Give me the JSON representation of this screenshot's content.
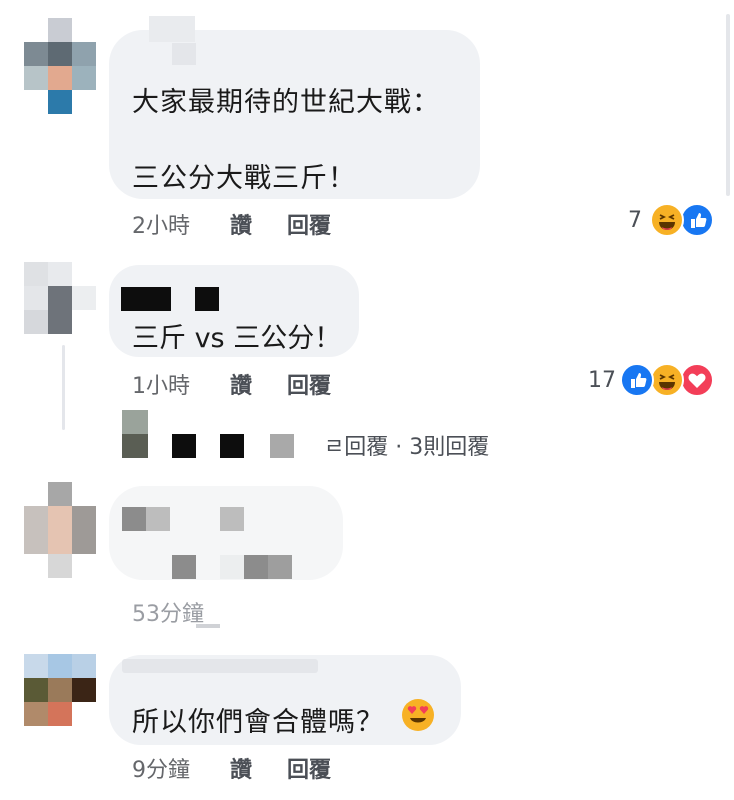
{
  "comments": [
    {
      "lines": [
        "大家最期待的世紀大戰：",
        "三公分大戰三斤！"
      ],
      "time": "2小時",
      "like": "讚",
      "reply": "回覆",
      "reaction_count": "7",
      "reactions": [
        "haha-icon",
        "like-icon"
      ]
    },
    {
      "lines": [
        "三斤 vs 三公分！"
      ],
      "time": "1小時",
      "like": "讚",
      "reply": "回覆",
      "reaction_count": "17",
      "reactions": [
        "like-icon",
        "haha-icon",
        "love-icon"
      ],
      "replies_summary": "已回覆 · 3則回覆",
      "replies_visible_text": "ㄹ回覆 · 3則回覆"
    },
    {
      "lines": [],
      "time": "53分鐘"
    },
    {
      "lines": [
        "所以你們會合體嗎？"
      ],
      "emoji": "heart-eyes-icon",
      "time": "9分鐘",
      "like": "讚",
      "reply": "回覆"
    }
  ],
  "colors": {
    "bubble": "#f0f2f5",
    "like_blue": "#1877f2",
    "haha_yellow": "#f7b125",
    "love_red": "#f33e58",
    "meta_gray": "#65676b"
  }
}
